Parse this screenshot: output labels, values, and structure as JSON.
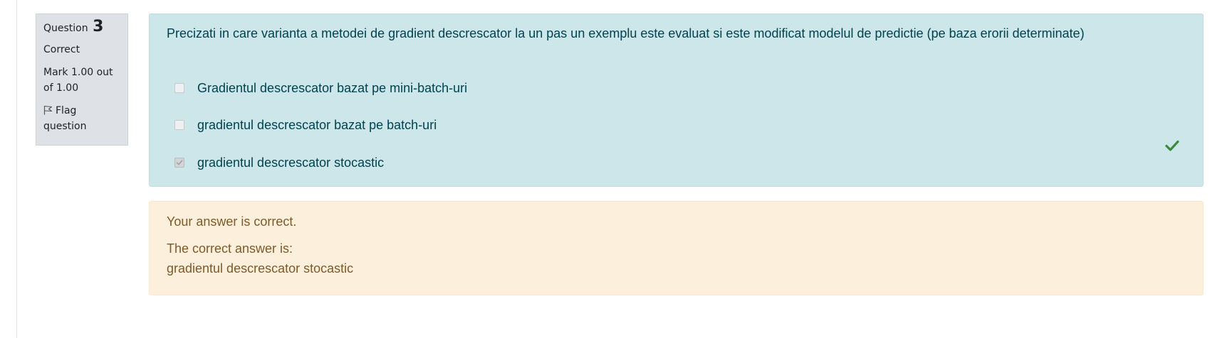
{
  "question_info": {
    "question_label": "Question",
    "question_number": "3",
    "state": "Correct",
    "grade": "Mark 1.00 out of 1.00",
    "flag_label": "Flag question"
  },
  "formulation": {
    "question_text": "Precizati in care varianta a metodei de gradient descrescator la un pas un exemplu este evaluat si este modificat modelul de predictie (pe baza erorii determinate)",
    "options": [
      {
        "label": "Gradientul descrescator bazat pe mini-batch-uri",
        "checked": false
      },
      {
        "label": "gradientul descrescator bazat pe batch-uri",
        "checked": false
      },
      {
        "label": "gradientul descrescator stocastic",
        "checked": true,
        "mark": "correct"
      }
    ]
  },
  "feedback": {
    "general": "Your answer is correct.",
    "right_answer_intro": "The correct answer is:",
    "right_answer": "gradientul descrescator stocastic"
  },
  "colors": {
    "formulation_bg": "#cce6ea",
    "formulation_text": "#00434e",
    "feedback_bg": "#fcefdc",
    "feedback_text": "#7d5a29",
    "correct_icon": "#3a8a3e",
    "info_bg": "#dee2e6"
  },
  "icons": {
    "flag": "flag-outline-icon",
    "correct": "check-icon"
  }
}
